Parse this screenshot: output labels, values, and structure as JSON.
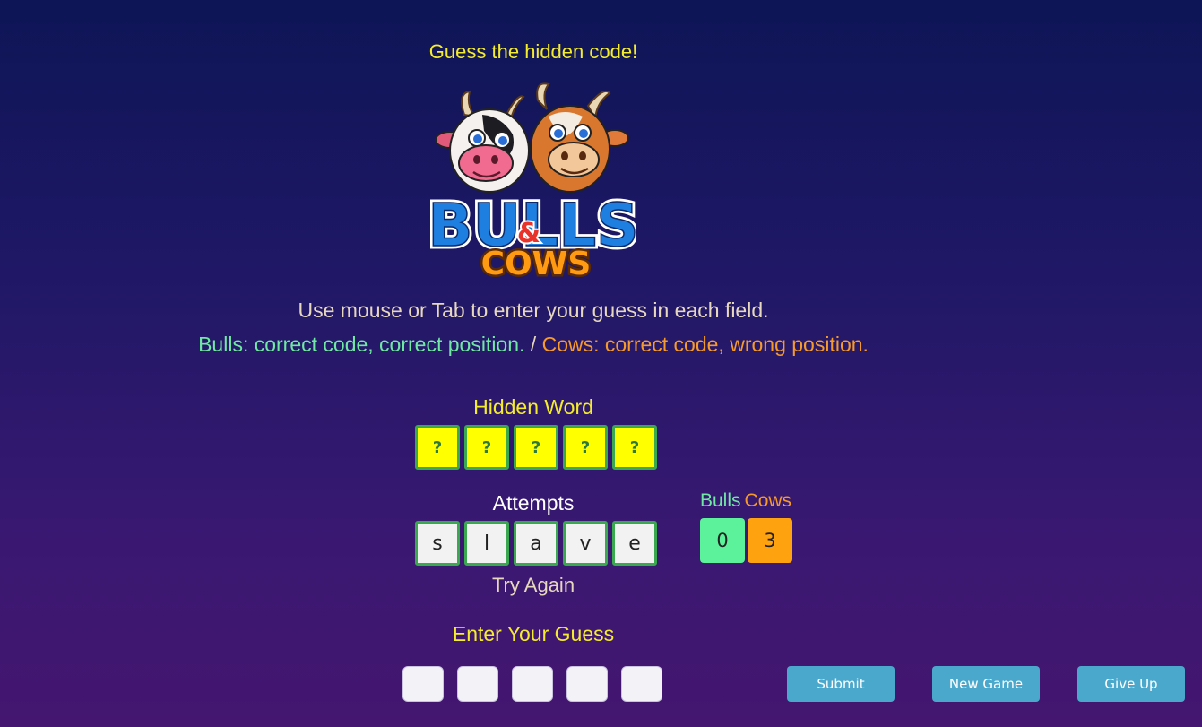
{
  "header": {
    "title": "Guess the hidden code!",
    "logo_top_text": "BULLS",
    "logo_amp": "&",
    "logo_bottom_text": "COWS"
  },
  "instructions": {
    "line1": "Use mouse or Tab to enter your guess in each field.",
    "bulls_text": "Bulls: correct code, correct position.",
    "separator": " / ",
    "cows_text": "Cows: correct code, wrong position."
  },
  "hidden": {
    "label": "Hidden Word",
    "tiles": [
      "?",
      "?",
      "?",
      "?",
      "?"
    ]
  },
  "attempts": {
    "label": "Attempts",
    "letters": [
      "s",
      "l",
      "a",
      "v",
      "e"
    ],
    "status": "Try Again"
  },
  "score": {
    "bulls_label": "Bulls",
    "cows_label": "Cows",
    "bulls_value": "0",
    "cows_value": "3"
  },
  "guess_input": {
    "label": "Enter Your Guess",
    "values": [
      "",
      "",
      "",
      "",
      ""
    ]
  },
  "buttons": {
    "submit": "Submit",
    "new_game": "New Game",
    "give_up": "Give Up"
  },
  "colors": {
    "accent_yellow": "#f5ec2c",
    "bulls_green": "#5cf29b",
    "cows_orange": "#ffa20f",
    "button_blue": "#4aa8cc",
    "tile_border_green": "#3aa84e"
  }
}
